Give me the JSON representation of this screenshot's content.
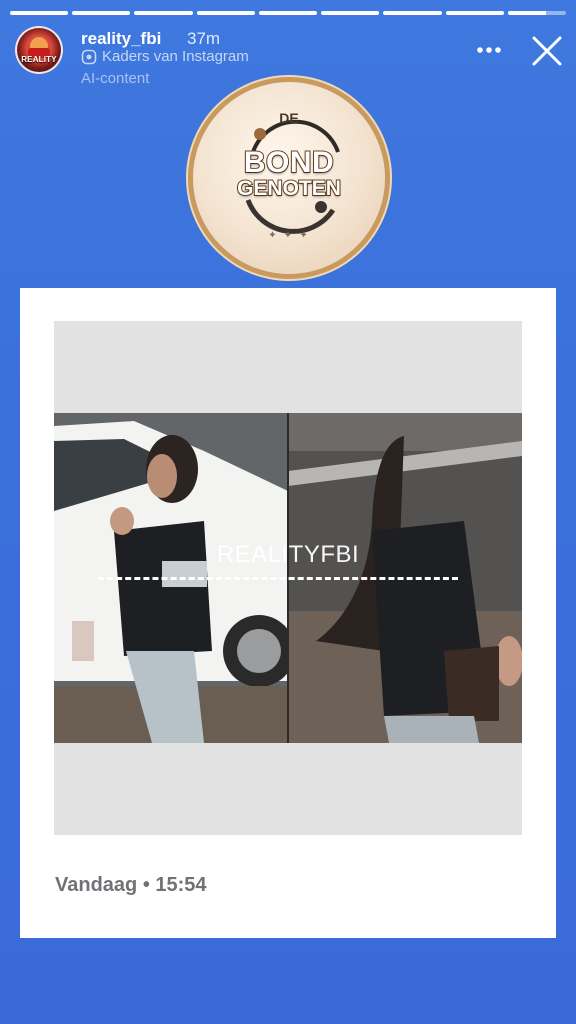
{
  "story": {
    "progress_segments_complete": 8,
    "progress_segments_total": 9,
    "current_segment_progress": 0.65
  },
  "header": {
    "avatar_text": "REALITY",
    "username": "reality_fbi",
    "time_ago": "37m",
    "source_label": "Kaders van Instagram",
    "ai_label": "AI-content",
    "more_icon": "more-horizontal-icon",
    "close_icon": "close-icon"
  },
  "sticker": {
    "line1": "DE",
    "line2": "BOND",
    "line3": "GENOTEN",
    "stars": "✦ ✦ ✦"
  },
  "post": {
    "watermark": "REALITYFBI",
    "caption": "Vandaag • 15:54"
  },
  "colors": {
    "background": "#3a6ad8",
    "card": "#ffffff",
    "caption_text": "#707276"
  }
}
